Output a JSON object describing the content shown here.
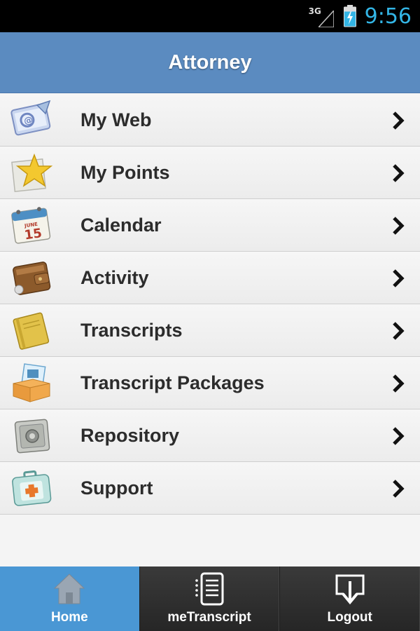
{
  "status_bar": {
    "network": "3G",
    "time": "9:56"
  },
  "header": {
    "title": "Attorney"
  },
  "menu": [
    {
      "label": "My Web",
      "icon": "web-browser-icon"
    },
    {
      "label": "My Points",
      "icon": "star-icon"
    },
    {
      "label": "Calendar",
      "icon": "calendar-icon",
      "calendar_month": "JUNE",
      "calendar_day": "15"
    },
    {
      "label": "Activity",
      "icon": "wallet-icon"
    },
    {
      "label": "Transcripts",
      "icon": "notebook-icon"
    },
    {
      "label": "Transcript Packages",
      "icon": "package-box-icon"
    },
    {
      "label": "Repository",
      "icon": "safe-icon"
    },
    {
      "label": "Support",
      "icon": "first-aid-kit-icon"
    }
  ],
  "tabs": [
    {
      "label": "Home",
      "icon": "home-icon",
      "active": true
    },
    {
      "label": "meTranscript",
      "icon": "tablet-document-icon",
      "active": false
    },
    {
      "label": "Logout",
      "icon": "logout-download-icon",
      "active": false
    }
  ],
  "colors": {
    "header_bg": "#5b8bc0",
    "active_tab": "#4a97d4",
    "tab_bar_bg": "#2e2e2e",
    "clock": "#33b5e5"
  }
}
